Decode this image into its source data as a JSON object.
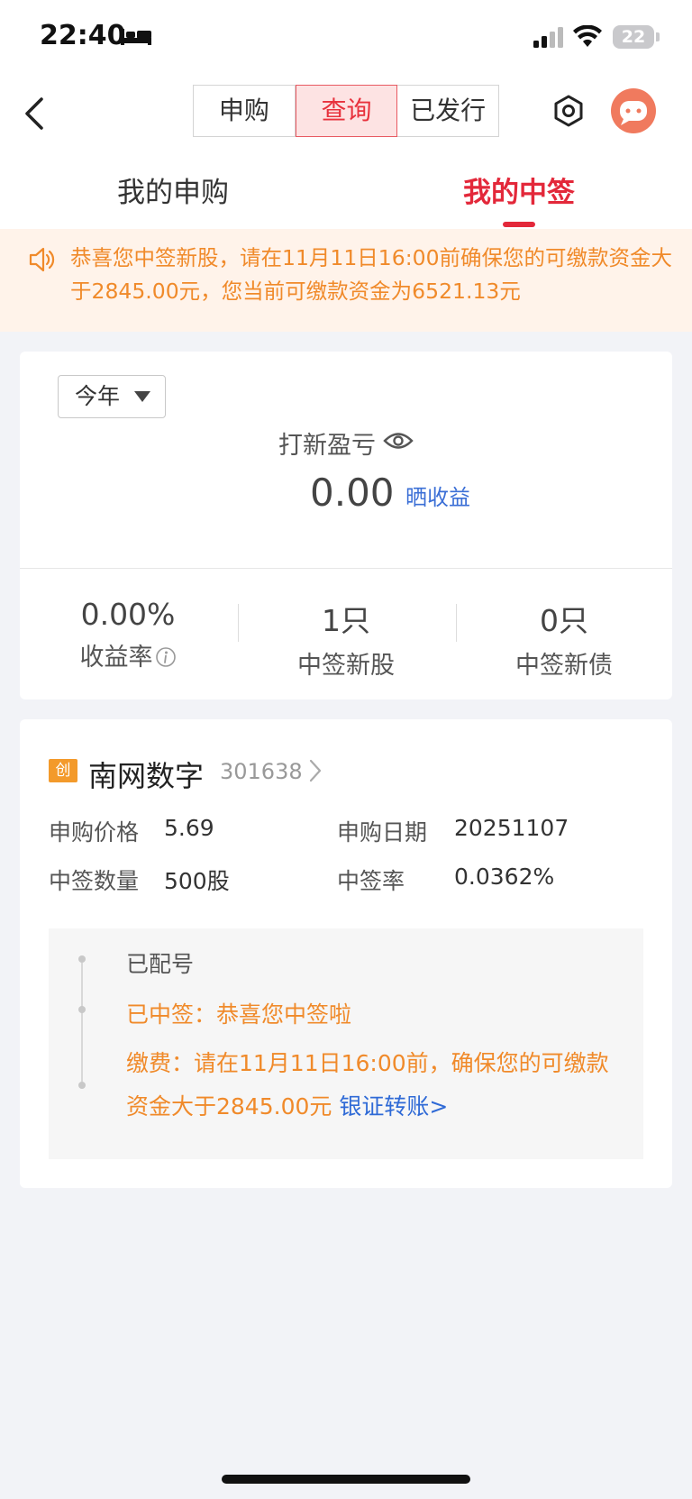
{
  "status_bar": {
    "time": "22:40",
    "battery": "22"
  },
  "nav": {
    "segments": [
      "申购",
      "查询",
      "已发行"
    ],
    "active_segment": "查询"
  },
  "subtabs": {
    "my_subscription": "我的申购",
    "my_allotment": "我的中签"
  },
  "notice": {
    "text": "恭喜您中签新股，请在11月11日16:00前确保您的可缴款资金大于2845.00元，您当前可缴款资金为6521.13元"
  },
  "summary": {
    "period": "今年",
    "pnl_label": "打新盈亏",
    "pnl_value": "0.00",
    "share_label": "晒收益",
    "stats": [
      {
        "value": "0.00%",
        "label": "收益率"
      },
      {
        "value": "1只",
        "label": "中签新股"
      },
      {
        "value": "0只",
        "label": "中签新债"
      }
    ]
  },
  "stock": {
    "board_badge": "创",
    "name": "南网数字",
    "code": "301638",
    "fields": {
      "price_label": "申购价格",
      "price": "5.69",
      "date_label": "申购日期",
      "date": "20251107",
      "qty_label": "中签数量",
      "qty": "500股",
      "rate_label": "中签率",
      "rate": "0.0362%"
    },
    "steps": {
      "assigned": "已配号",
      "won": "已中签：恭喜您中签啦",
      "payment": "缴费：请在11月11日16:00前，确保您的可缴款资金大于2845.00元",
      "transfer_link": "银证转账>"
    }
  },
  "colors": {
    "accent_red": "#e3283a",
    "notice_orange": "#f08a2a",
    "link_blue": "#3b6fd6",
    "badge_orange": "#f39a2b"
  }
}
